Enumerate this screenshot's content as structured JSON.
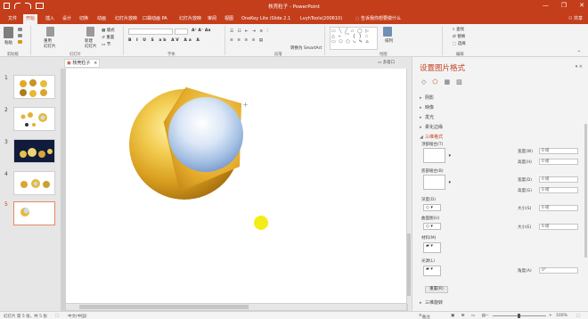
{
  "window": {
    "title": "核壳粒子 - PowerPoint",
    "controls": [
      "—",
      "❐",
      "✕"
    ]
  },
  "tabs": [
    "文件",
    "开始",
    "插入",
    "设计",
    "切换",
    "动画",
    "幻灯片放映",
    "口袋动画 PA",
    "幻灯片放映",
    "审阅",
    "视图",
    "OneKey Lite",
    "iSlide 2.1",
    "LvyhTools(200610)",
    "告诉我你想要做什么"
  ],
  "active_tab": "开始",
  "user": "共享",
  "ribbon": {
    "paste": "粘贴",
    "new_slide": "新建\n幻灯片",
    "reuse": "重用\n幻灯片",
    "layout": "版式",
    "reset": "重置",
    "section": "节",
    "font_name": "",
    "font_size": "",
    "draw_label": "排列",
    "edit": [
      "查找",
      "替换",
      "选择"
    ],
    "convert_smartart": "转换为 SmartArt",
    "groups": [
      "剪贴板",
      "幻灯片",
      "字体",
      "段落",
      "绘图",
      "编辑"
    ]
  },
  "doc_tab": "核壳粒子",
  "slides": [
    {
      "num": "1"
    },
    {
      "num": "2"
    },
    {
      "num": "3"
    },
    {
      "num": "4"
    },
    {
      "num": "5"
    }
  ],
  "right_panel": {
    "title": "设置图片格式",
    "sections": [
      "阴影",
      "映像",
      "发光",
      "柔化边缘",
      "三维格式"
    ],
    "fields": [
      {
        "label": "顶部棱台(T)"
      },
      {
        "label": "底部棱台(B)"
      },
      {
        "label": "深度(D)"
      },
      {
        "label": "曲面图(U)"
      },
      {
        "label": "材料(M)"
      },
      {
        "label": "光源(L)"
      }
    ],
    "numbers": [
      {
        "label": "宽度(W)",
        "value": "0 磅"
      },
      {
        "label": "高度(H)",
        "value": "0 磅"
      },
      {
        "label": "宽度(D)",
        "value": "0 磅"
      },
      {
        "label": "高度(G)",
        "value": "0 磅"
      },
      {
        "label": "大小(S)",
        "value": "0 磅"
      },
      {
        "label": "大小(E)",
        "value": "0 磅"
      },
      {
        "label": "角度(A)",
        "value": "0°"
      }
    ],
    "reset": "重置(R)",
    "more": "三维旋转"
  },
  "status": {
    "slide_info": "幻灯片 第 5 张，共 5 张",
    "language": "中文(中国)",
    "notes": "备注",
    "zoom": "100%"
  },
  "colors": {
    "accent": "#c43e1c",
    "sphere_gold": "#e8b838",
    "core_blue": "#b9d3ee"
  }
}
